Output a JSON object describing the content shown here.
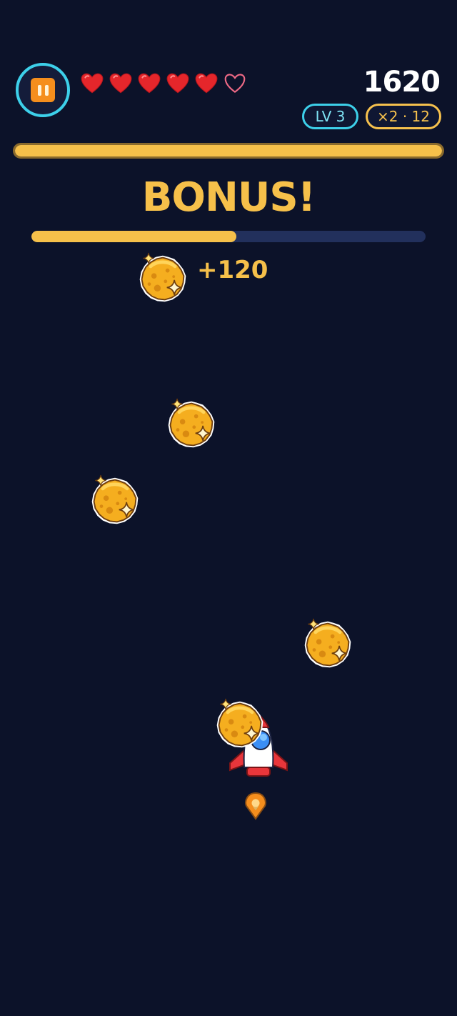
{
  "hud": {
    "score": "1620",
    "level_label": "LV 3",
    "combo_label": "×2 · 12",
    "lives": {
      "filled": 5,
      "empty": 1
    },
    "top_progress": 1.0,
    "pause_icon": "pause-icon"
  },
  "bonus": {
    "title": "BONUS!",
    "progress": 0.52,
    "points_label": "+120"
  },
  "colors": {
    "background": "#0c1229",
    "accent_yellow": "#f6c04a",
    "accent_cyan": "#3dd0ea",
    "heart_red": "#e5262b",
    "pause_orange": "#f58e1d"
  },
  "icons": {
    "coin": "moon-coin-icon",
    "player": "rocket-icon",
    "heart": "heart-icon",
    "flame": "flame-icon"
  }
}
